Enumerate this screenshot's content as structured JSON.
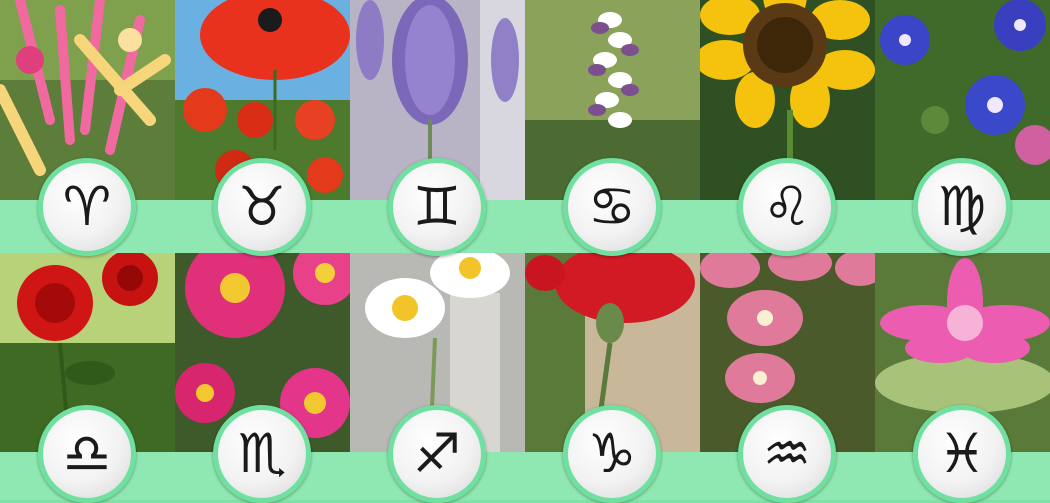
{
  "colors": {
    "band": "#8fe8b1",
    "badge_ring": "#6fe0a0"
  },
  "tiles_top": [
    {
      "flower": "honeysuckle",
      "sign_symbol": "♈"
    },
    {
      "flower": "red-poppy",
      "sign_symbol": "♉"
    },
    {
      "flower": "lavender",
      "sign_symbol": "♊"
    },
    {
      "flower": "acanthus",
      "sign_symbol": "♋"
    },
    {
      "flower": "sunflower",
      "sign_symbol": "♌"
    },
    {
      "flower": "morning-glory",
      "sign_symbol": "♍"
    }
  ],
  "tiles_bottom": [
    {
      "flower": "red-rose",
      "sign_symbol": "♎"
    },
    {
      "flower": "pink-chrysanthemum",
      "sign_symbol": "♏"
    },
    {
      "flower": "narcissus",
      "sign_symbol": "♐"
    },
    {
      "flower": "red-carnation",
      "sign_symbol": "♑"
    },
    {
      "flower": "pink-orchid",
      "sign_symbol": "♒"
    },
    {
      "flower": "pink-water-lily",
      "sign_symbol": "♓"
    }
  ]
}
